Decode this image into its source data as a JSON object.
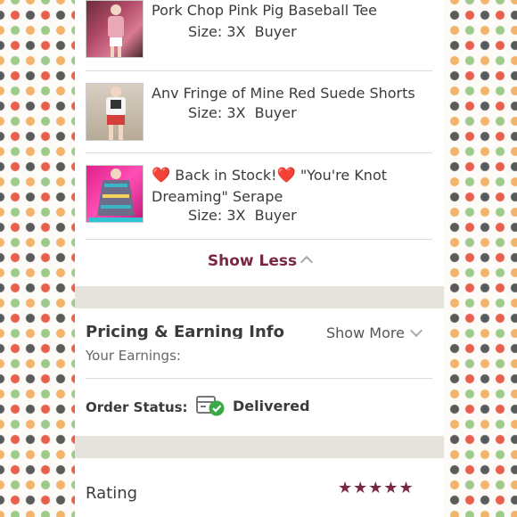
{
  "items": [
    {
      "title": "Pork Chop Pink Pig Baseball Tee",
      "size": "Size: 3X",
      "buyer_label": "Buyer:"
    },
    {
      "title": "Anv Fringe of Mine Red Suede Shorts",
      "size": "Size: 3X",
      "buyer_label": "Buyer:"
    },
    {
      "title_prefix": "❤️",
      "title_mid": "Back in Stock!",
      "title_heart2": "❤️",
      "title_rest": " \"You're Knot Dreaming\" Serape",
      "size": "Size: 3X",
      "buyer_label": "Buyer:"
    }
  ],
  "show_less": "Show Less",
  "pricing": {
    "title": "Pricing & Earning Info",
    "show_more": "Show More",
    "earnings_label": "Your Earnings:"
  },
  "order_status": {
    "label": "Order Status:",
    "value": "Delivered"
  },
  "rating": {
    "label": "Rating",
    "stars": "★★★★★",
    "value": 5
  },
  "colors": {
    "accent": "#7a2746",
    "band": "#e6e3dd",
    "delivered_check": "#3aa845"
  }
}
